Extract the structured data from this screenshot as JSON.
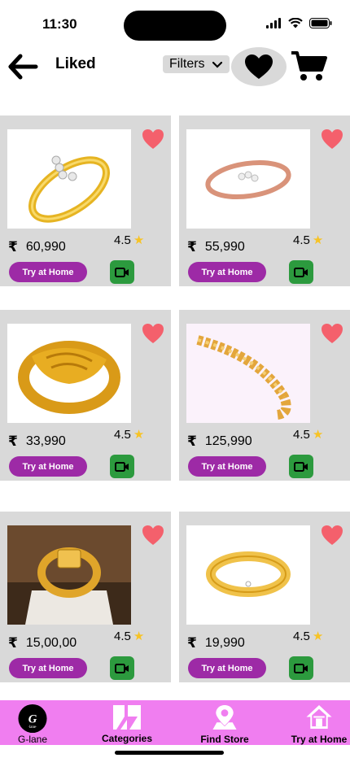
{
  "status_bar": {
    "time": "11:30"
  },
  "header": {
    "back_icon": "arrow-left-icon",
    "title": "Liked",
    "filters_label": "Filters",
    "liked_icon": "heart-icon",
    "cart_icon": "cart-icon"
  },
  "products": [
    {
      "price": "60,990",
      "rating": "4.5",
      "try_label": "Try at Home",
      "image": "gold diamond ring"
    },
    {
      "price": "55,990",
      "rating": "4.5",
      "try_label": "Try at Home",
      "image": "rose gold diamond ring"
    },
    {
      "price": "33,990",
      "rating": "4.5",
      "try_label": "Try at Home",
      "image": "gold hands ring"
    },
    {
      "price": "125,990",
      "rating": "4.5",
      "try_label": "Try at Home",
      "image": "gold rope bracelet"
    },
    {
      "price": "15,00,00",
      "rating": "4.5",
      "try_label": "Try at Home",
      "image": "gold signet ring"
    },
    {
      "price": "19,990",
      "rating": "4.5",
      "try_label": "Try at Home",
      "image": "gold band ring"
    }
  ],
  "bottom_nav": {
    "items": [
      {
        "label": "G-lane",
        "icon": "glane-logo"
      },
      {
        "label": "Categories",
        "icon": "categories-icon"
      },
      {
        "label": "Find Store",
        "icon": "store-location-icon"
      },
      {
        "label": "Try at Home",
        "icon": "home-icon"
      }
    ]
  },
  "colors": {
    "card_bg": "#d9d9d9",
    "try_button": "#9d2aa6",
    "video_button": "#2c9a3e",
    "heart": "#f4606c",
    "nav_bg": "#f07ef0",
    "star": "#f7c325"
  }
}
